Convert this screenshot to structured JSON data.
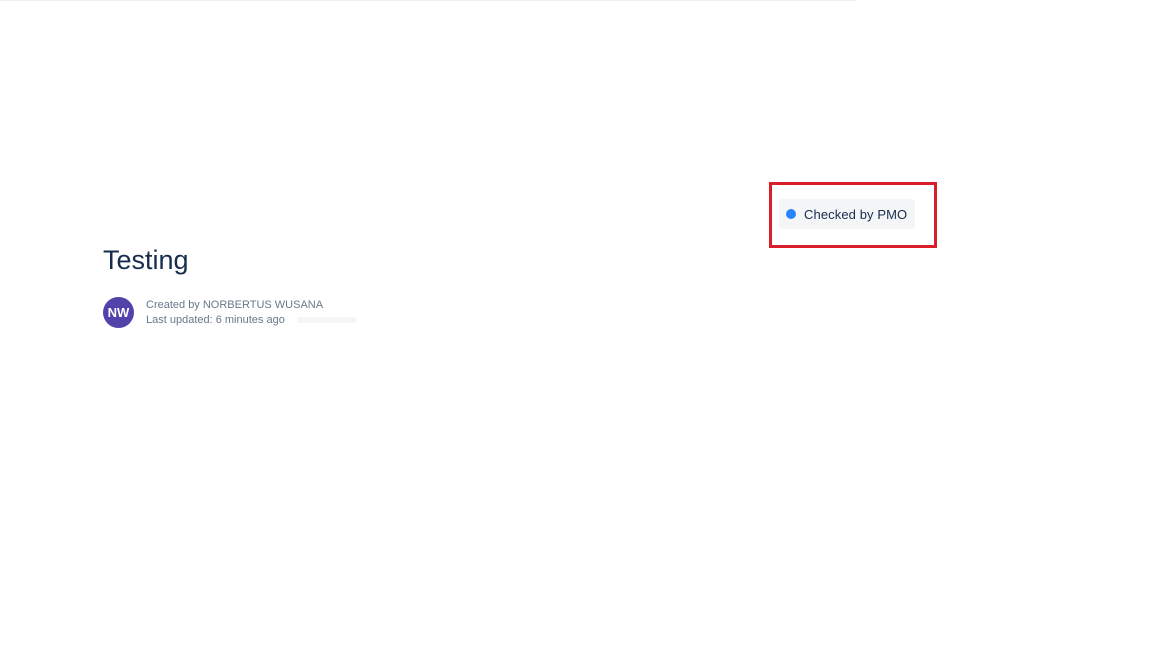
{
  "page": {
    "title": "Testing"
  },
  "status": {
    "label": "Checked by PMO",
    "dot_color": "#2684ff",
    "highlight_color": "#d9202a"
  },
  "byline": {
    "avatar_initials": "NW",
    "avatar_color": "#5243aa",
    "created_text": "Created by NORBERTUS WUSANA",
    "updated_text": "Last updated: 6 minutes ago"
  }
}
